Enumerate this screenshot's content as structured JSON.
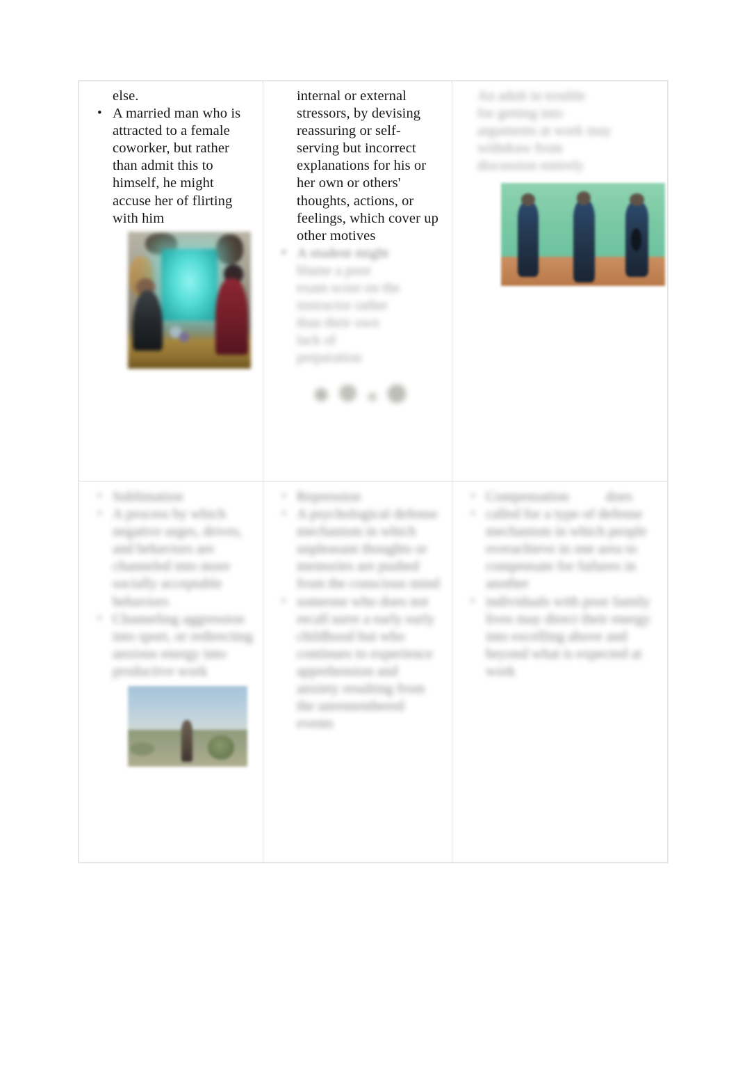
{
  "document": {
    "page_background": "#ffffff",
    "table_border_color": "#e3e4e5",
    "text_color": "#18181a"
  },
  "table": {
    "rows": [
      {
        "row_index": 1,
        "cells": [
          {
            "column": 1,
            "legible": true,
            "continuation_line": "else.",
            "bullets": [
              "A married man who is attracted to a female coworker, but rather than admit this to himself, he might accuse her of flirting with him"
            ],
            "figure": {
              "name": "office-scene-image",
              "alt": "Blurred photo of an office interior with a glowing cyan monitor and several seated figures",
              "dominant_colors": [
                "#56dcd6",
                "#8b2733",
                "#22262a",
                "#8f7030"
              ]
            }
          },
          {
            "column": 2,
            "legible": true,
            "continuation_text": "internal or external stressors, by devising reassuring or self-serving but incorrect explanations for his or her own or others' thoughts, actions, or feelings, which cover up other motives",
            "bullets": [
              {
                "legible": false,
                "redacted_note": "blurred text — unreadable",
                "placeholder_lines": [
                  "A student might",
                  "blame a poor",
                  "exam score on the",
                  "instructor rather",
                  "than their own",
                  "lack of",
                  "preparation"
                ]
              }
            ],
            "figure": {
              "name": "blurred-inline-figure",
              "alt": "Faint blurred inline graphic below the second bullet",
              "legible": false
            }
          },
          {
            "column": 3,
            "legible": false,
            "redacted_note": "blurred text — unreadable",
            "placeholder_lines": [
              "An adult in trouble",
              "for getting into",
              "arguments at work may",
              "withdraw from",
              "discussion entirely"
            ],
            "figure": {
              "name": "three-figures-image",
              "alt": "Blurred photo of three dark-clothed figures standing against a teal green wall on clay-colored ground",
              "dominant_colors": [
                "#79c8a4",
                "#c08253",
                "#24384f"
              ]
            }
          }
        ]
      },
      {
        "row_index": 2,
        "cells": [
          {
            "column": 1,
            "legible": false,
            "redacted_note": "blurred text — unreadable",
            "heading_placeholder": "Sublimation",
            "bullets": [
              {
                "legible": false,
                "placeholder_lines": [
                  "A process by",
                  "which negative",
                  "urges, drives, and",
                  "behaviors are",
                  "channeled into",
                  "more socially",
                  "acceptable",
                  "behaviors"
                ]
              },
              {
                "legible": false,
                "placeholder_lines": [
                  "Channeling",
                  "aggression into",
                  "sport, or",
                  "redirecting anxious",
                  "energy into",
                  "productive work"
                ]
              }
            ],
            "figure": {
              "name": "outdoor-field-image",
              "alt": "Blurred landscape photo with pale blue sky, olive field, and a lone standing figure",
              "dominant_colors": [
                "#b4cddd",
                "#9aa184",
                "#55493f"
              ]
            }
          },
          {
            "column": 2,
            "legible": false,
            "redacted_note": "blurred text — unreadable",
            "heading_placeholder": "Repression",
            "bullets": [
              {
                "legible": false,
                "placeholder_lines": [
                  "A psychological",
                  "defense",
                  "mechanism in",
                  "which unpleasant",
                  "thoughts or",
                  "memories are",
                  "pushed from the",
                  "conscious mind"
                ]
              },
              {
                "legible": false,
                "placeholder_lines": [
                  "someone who",
                  "does not recall",
                  "ките a early",
                  "early childhood",
                  "but who",
                  "continues to",
                  "experience",
                  "apprehension and",
                  "anxiety resulting",
                  "from the",
                  "unremembered",
                  "events"
                ]
              }
            ]
          },
          {
            "column": 3,
            "legible": false,
            "redacted_note": "blurred text — unreadable",
            "heading_placeholder": "Compensation",
            "heading_suffix_placeholder": "does",
            "bullets": [
              {
                "legible": false,
                "placeholder_lines": [
                  "called for a type of",
                  "defense mechanism in",
                  "which people",
                  "overachieve in one",
                  "area to compensate",
                  "for failures in another"
                ]
              },
              {
                "legible": false,
                "placeholder_lines": [
                  "individuals with poor",
                  "family lives may direct",
                  "their energy into",
                  "excelling above and",
                  "beyond what is",
                  "expected at work"
                ]
              }
            ]
          }
        ]
      }
    ]
  }
}
